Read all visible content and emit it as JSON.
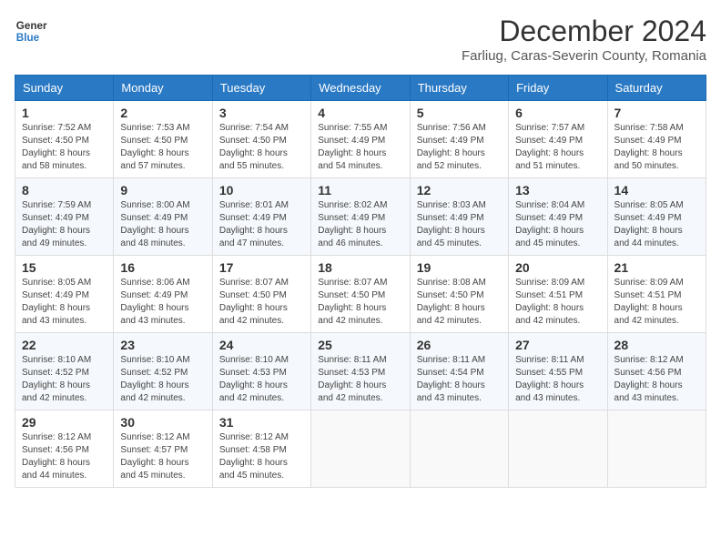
{
  "logo": {
    "line1": "General",
    "line2": "Blue"
  },
  "title": "December 2024",
  "subtitle": "Farliug, Caras-Severin County, Romania",
  "days_of_week": [
    "Sunday",
    "Monday",
    "Tuesday",
    "Wednesday",
    "Thursday",
    "Friday",
    "Saturday"
  ],
  "weeks": [
    [
      {
        "day": "1",
        "info": "Sunrise: 7:52 AM\nSunset: 4:50 PM\nDaylight: 8 hours and 58 minutes."
      },
      {
        "day": "2",
        "info": "Sunrise: 7:53 AM\nSunset: 4:50 PM\nDaylight: 8 hours and 57 minutes."
      },
      {
        "day": "3",
        "info": "Sunrise: 7:54 AM\nSunset: 4:50 PM\nDaylight: 8 hours and 55 minutes."
      },
      {
        "day": "4",
        "info": "Sunrise: 7:55 AM\nSunset: 4:49 PM\nDaylight: 8 hours and 54 minutes."
      },
      {
        "day": "5",
        "info": "Sunrise: 7:56 AM\nSunset: 4:49 PM\nDaylight: 8 hours and 52 minutes."
      },
      {
        "day": "6",
        "info": "Sunrise: 7:57 AM\nSunset: 4:49 PM\nDaylight: 8 hours and 51 minutes."
      },
      {
        "day": "7",
        "info": "Sunrise: 7:58 AM\nSunset: 4:49 PM\nDaylight: 8 hours and 50 minutes."
      }
    ],
    [
      {
        "day": "8",
        "info": "Sunrise: 7:59 AM\nSunset: 4:49 PM\nDaylight: 8 hours and 49 minutes."
      },
      {
        "day": "9",
        "info": "Sunrise: 8:00 AM\nSunset: 4:49 PM\nDaylight: 8 hours and 48 minutes."
      },
      {
        "day": "10",
        "info": "Sunrise: 8:01 AM\nSunset: 4:49 PM\nDaylight: 8 hours and 47 minutes."
      },
      {
        "day": "11",
        "info": "Sunrise: 8:02 AM\nSunset: 4:49 PM\nDaylight: 8 hours and 46 minutes."
      },
      {
        "day": "12",
        "info": "Sunrise: 8:03 AM\nSunset: 4:49 PM\nDaylight: 8 hours and 45 minutes."
      },
      {
        "day": "13",
        "info": "Sunrise: 8:04 AM\nSunset: 4:49 PM\nDaylight: 8 hours and 45 minutes."
      },
      {
        "day": "14",
        "info": "Sunrise: 8:05 AM\nSunset: 4:49 PM\nDaylight: 8 hours and 44 minutes."
      }
    ],
    [
      {
        "day": "15",
        "info": "Sunrise: 8:05 AM\nSunset: 4:49 PM\nDaylight: 8 hours and 43 minutes."
      },
      {
        "day": "16",
        "info": "Sunrise: 8:06 AM\nSunset: 4:49 PM\nDaylight: 8 hours and 43 minutes."
      },
      {
        "day": "17",
        "info": "Sunrise: 8:07 AM\nSunset: 4:50 PM\nDaylight: 8 hours and 42 minutes."
      },
      {
        "day": "18",
        "info": "Sunrise: 8:07 AM\nSunset: 4:50 PM\nDaylight: 8 hours and 42 minutes."
      },
      {
        "day": "19",
        "info": "Sunrise: 8:08 AM\nSunset: 4:50 PM\nDaylight: 8 hours and 42 minutes."
      },
      {
        "day": "20",
        "info": "Sunrise: 8:09 AM\nSunset: 4:51 PM\nDaylight: 8 hours and 42 minutes."
      },
      {
        "day": "21",
        "info": "Sunrise: 8:09 AM\nSunset: 4:51 PM\nDaylight: 8 hours and 42 minutes."
      }
    ],
    [
      {
        "day": "22",
        "info": "Sunrise: 8:10 AM\nSunset: 4:52 PM\nDaylight: 8 hours and 42 minutes."
      },
      {
        "day": "23",
        "info": "Sunrise: 8:10 AM\nSunset: 4:52 PM\nDaylight: 8 hours and 42 minutes."
      },
      {
        "day": "24",
        "info": "Sunrise: 8:10 AM\nSunset: 4:53 PM\nDaylight: 8 hours and 42 minutes."
      },
      {
        "day": "25",
        "info": "Sunrise: 8:11 AM\nSunset: 4:53 PM\nDaylight: 8 hours and 42 minutes."
      },
      {
        "day": "26",
        "info": "Sunrise: 8:11 AM\nSunset: 4:54 PM\nDaylight: 8 hours and 43 minutes."
      },
      {
        "day": "27",
        "info": "Sunrise: 8:11 AM\nSunset: 4:55 PM\nDaylight: 8 hours and 43 minutes."
      },
      {
        "day": "28",
        "info": "Sunrise: 8:12 AM\nSunset: 4:56 PM\nDaylight: 8 hours and 43 minutes."
      }
    ],
    [
      {
        "day": "29",
        "info": "Sunrise: 8:12 AM\nSunset: 4:56 PM\nDaylight: 8 hours and 44 minutes."
      },
      {
        "day": "30",
        "info": "Sunrise: 8:12 AM\nSunset: 4:57 PM\nDaylight: 8 hours and 45 minutes."
      },
      {
        "day": "31",
        "info": "Sunrise: 8:12 AM\nSunset: 4:58 PM\nDaylight: 8 hours and 45 minutes."
      },
      null,
      null,
      null,
      null
    ]
  ]
}
